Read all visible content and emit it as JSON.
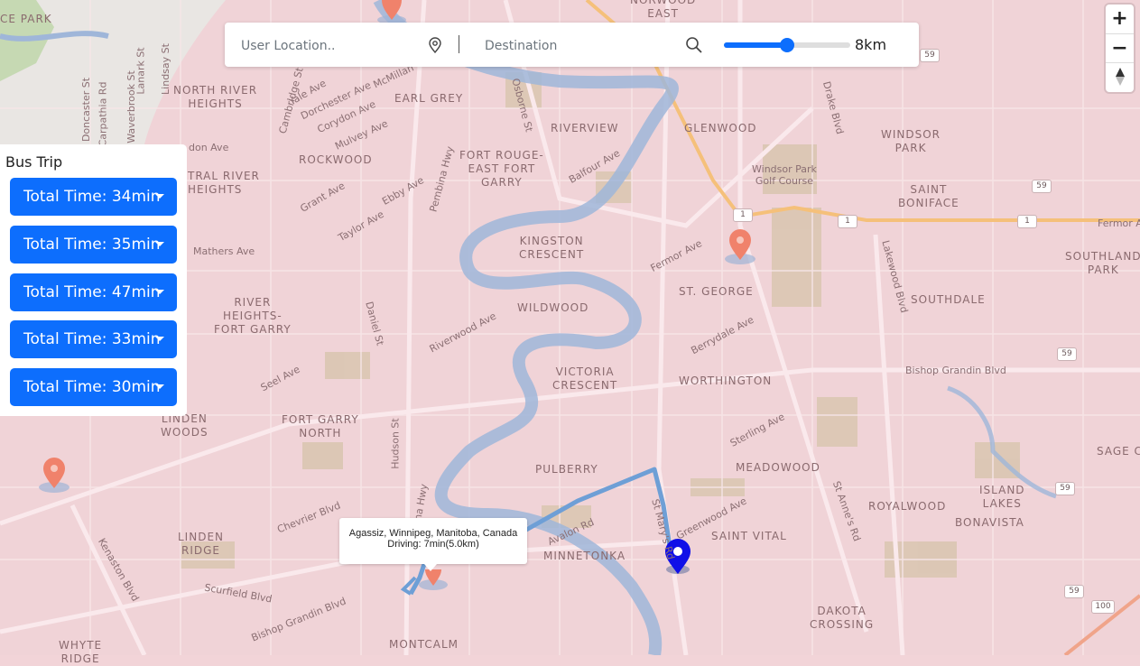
{
  "search": {
    "user_placeholder": "User Location..",
    "destination_placeholder": "Destination",
    "radius_label": "8km",
    "radius_fraction": 0.5
  },
  "zoom": {
    "zoom_in": "+",
    "zoom_out": "−"
  },
  "trip_panel": {
    "title": "Bus Trip",
    "options": [
      "Total Time: 34min",
      "Total Time: 35min",
      "Total Time: 47min",
      "Total Time: 33min",
      "Total Time: 30min"
    ]
  },
  "popup": {
    "line1": "Agassiz, Winnipeg, Manitoba, Canada",
    "line2": "Driving: 7min(5.0km)"
  },
  "map": {
    "neighbourhoods": [
      "CE PARK",
      "NORWOOD\nEAST",
      "NORTH RIVER\nHEIGHTS",
      "EARL GREY",
      "RIVERVIEW",
      "GLENWOOD",
      "WINDSOR\nPARK",
      "ROCKWOOD",
      "FORT ROUGE-\nEAST FORT\nGARRY",
      "TRAL RIVER\nHEIGHTS",
      "SAINT\nBONIFACE",
      "KINGSTON\nCRESCENT",
      "SOUTHLAND\nPARK",
      "ST. GEORGE",
      "SOUTHDALE",
      "RIVER\nHEIGHTS-\nFORT GARRY",
      "WILDWOOD",
      "VICTORIA\nCRESCENT",
      "WORTHINGTON",
      "LINDEN\nWOODS",
      "FORT GARRY\nNORTH",
      "PULBERRY",
      "MEADOWOOD",
      "SAGE C",
      "ISLAND\nLAKES",
      "ROYALWOOD",
      "BONAVISTA",
      "LINDEN\nRIDGE",
      "MINNETONKA",
      "SAINT VITAL",
      "DAKOTA\nCROSSING",
      "MONTCALM",
      "WHYTE\nRIDGE"
    ],
    "streets": [
      "Doncaster St",
      "Carpathia Rd",
      "Waverbrook St",
      "Lanark St",
      "Lindsay St",
      "Yale Ave",
      "Cambridge St",
      "Dorchester Ave",
      "Corydon Ave",
      "McMillan",
      "Mulvey Ave",
      "Osborne St",
      "Drake Blvd",
      "Windsor Park\nGolf Course",
      "Grant Ave",
      "Ebby Ave",
      "Pembina Hwy",
      "Balfour Ave",
      "Taylor Ave",
      "don Ave",
      "Mathers Ave",
      "Fermor Ave",
      "Fermor Av",
      "Lakewood Blvd",
      "Daniel St",
      "Riverwood Ave",
      "Berrydale Ave",
      "Seel Ave",
      "Bishop Grandin Blvd",
      "Hudson St",
      "Sterling Ave",
      "St Anne's Rd",
      "Chevrier Blvd",
      "Avalon Rd",
      "Greenwood Ave",
      "St Mary's Rd",
      "Kenaston Blvd",
      "Scurfield Blvd",
      "Bishop Grandin Blvd",
      "bina Hwy"
    ],
    "highway_badges": [
      "59",
      "59",
      "1",
      "1",
      "1",
      "59",
      "59",
      "59",
      "100"
    ]
  }
}
